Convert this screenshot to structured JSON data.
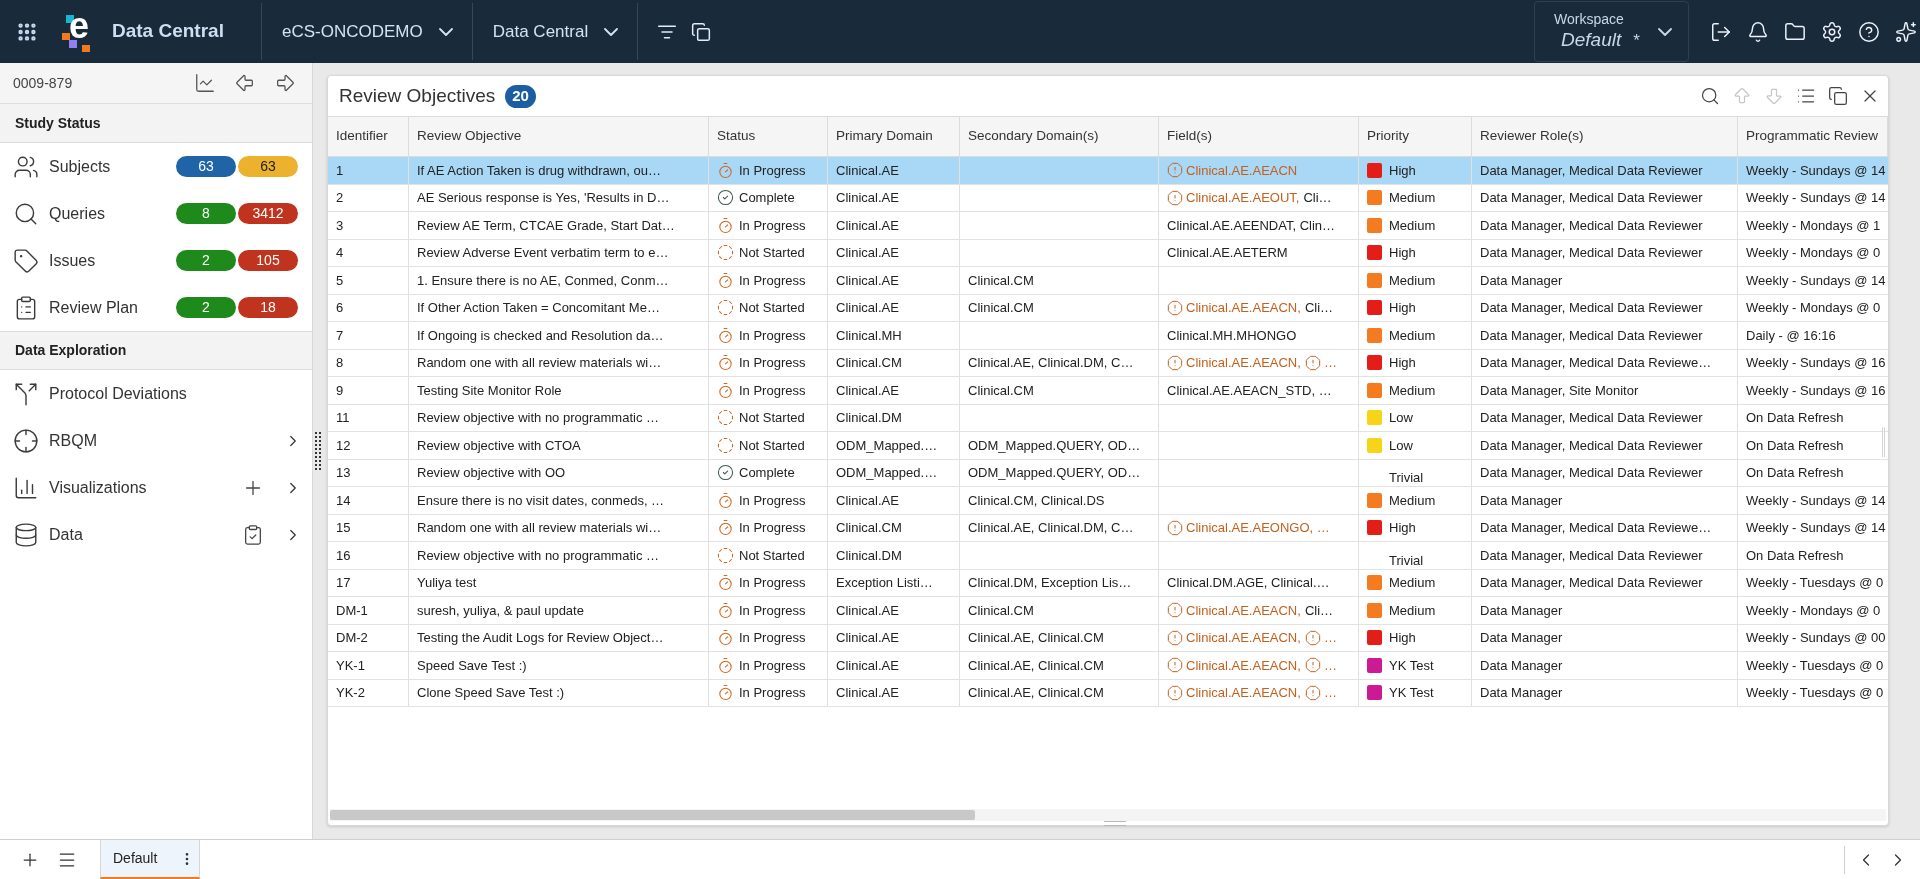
{
  "app_bar": {
    "logo_mark": "e",
    "title": "Data Central",
    "menus": [
      {
        "label": "eCS-ONCODEMO"
      },
      {
        "label": "Data Central"
      }
    ],
    "workspace": {
      "label": "Workspace",
      "value": "Default",
      "unsaved_mark": "*"
    }
  },
  "sidebar": {
    "record_id": "0009-879",
    "sections": [
      {
        "title": "Study Status",
        "items": [
          {
            "kind": "counts",
            "label": "Subjects",
            "badges": [
              {
                "value": "63",
                "color": "#1f64a6"
              },
              {
                "value": "63",
                "color": "#ecb22e"
              }
            ]
          },
          {
            "kind": "counts",
            "label": "Queries",
            "badges": [
              {
                "value": "8",
                "color": "#1f8a1c"
              },
              {
                "value": "3412",
                "color": "#c0341f"
              }
            ]
          },
          {
            "kind": "counts",
            "label": "Issues",
            "badges": [
              {
                "value": "2",
                "color": "#1f8a1c"
              },
              {
                "value": "105",
                "color": "#c0341f"
              }
            ]
          },
          {
            "kind": "counts",
            "label": "Review Plan",
            "badges": [
              {
                "value": "2",
                "color": "#1f8a1c"
              },
              {
                "value": "18",
                "color": "#c0341f"
              }
            ]
          }
        ]
      },
      {
        "title": "Data Exploration",
        "items": [
          {
            "kind": "link",
            "label": "Protocol Deviations"
          },
          {
            "kind": "submenu",
            "label": "RBQM"
          },
          {
            "kind": "submenu",
            "label": "Visualizations"
          },
          {
            "kind": "submenu",
            "label": "Data"
          }
        ]
      }
    ]
  },
  "panel": {
    "title": "Review Objectives",
    "count": "20",
    "toolbar": [
      {
        "disabled": false
      },
      {
        "disabled": true
      },
      {
        "disabled": true
      },
      {
        "disabled": false
      },
      {
        "disabled": false
      },
      {
        "disabled": false
      }
    ]
  },
  "table": {
    "columns": [
      "Identifier",
      "Review Objective",
      "Status",
      "Primary Domain",
      "Secondary Domain(s)",
      "Field(s)",
      "Priority",
      "Reviewer Role(s)",
      "Programmatic Review"
    ],
    "rows": [
      {
        "selected": true,
        "id": "1",
        "objective": "If AE Action Taken is drug withdrawn, ou…",
        "status": {
          "kind": "in_progress",
          "label": "In Progress"
        },
        "primary": "Clinical.AE",
        "fields": [
          {
            "text": "Clinical.AE.AEACN",
            "flagged": true
          }
        ],
        "priority": {
          "label": "High",
          "color": "#e31e18"
        },
        "roles": "Data Manager, Medical Data Reviewer",
        "schedule": "Weekly - Sundays @ 14"
      },
      {
        "selected": false,
        "id": "2",
        "objective": "AE Serious response is Yes, 'Results in D…",
        "status": {
          "kind": "complete",
          "label": "Complete"
        },
        "primary": "Clinical.AE",
        "fields": [
          {
            "text": "Clinical.AE.AEOUT,",
            "flagged": true
          },
          {
            "text": "Cli…",
            "flagged": false
          }
        ],
        "priority": {
          "label": "Medium",
          "color": "#f47b20"
        },
        "roles": "Data Manager, Medical Data Reviewer",
        "schedule": "Weekly - Sundays @ 14"
      },
      {
        "selected": false,
        "id": "3",
        "objective": "Review AE Term, CTCAE Grade, Start Dat…",
        "status": {
          "kind": "in_progress",
          "label": "In Progress"
        },
        "primary": "Clinical.AE",
        "fields": [
          {
            "text": "Clinical.AE.AEENDAT, Clin…",
            "flagged": false
          }
        ],
        "priority": {
          "label": "Medium",
          "color": "#f47b20"
        },
        "roles": "Data Manager, Medical Data Reviewer",
        "schedule": "Weekly - Mondays @ 1"
      },
      {
        "selected": false,
        "id": "4",
        "objective": "Review Adverse Event verbatim term to e…",
        "status": {
          "kind": "not_started",
          "label": "Not Started"
        },
        "primary": "Clinical.AE",
        "fields": [
          {
            "text": "Clinical.AE.AETERM",
            "flagged": false
          }
        ],
        "priority": {
          "label": "High",
          "color": "#e31e18"
        },
        "roles": "Data Manager, Medical Data Reviewer",
        "schedule": "Weekly - Mondays @ 0"
      },
      {
        "selected": false,
        "id": "5",
        "objective": "1. Ensure there is no AE, Conmed, Conm…",
        "status": {
          "kind": "in_progress",
          "label": "In Progress"
        },
        "primary": "Clinical.AE",
        "secondary": "Clinical.CM",
        "priority": {
          "label": "Medium",
          "color": "#f47b20"
        },
        "roles": "Data Manager",
        "schedule": "Weekly - Sundays @ 14"
      },
      {
        "selected": false,
        "id": "6",
        "objective": "If Other Action Taken = Concomitant Me…",
        "status": {
          "kind": "not_started",
          "label": "Not Started"
        },
        "primary": "Clinical.AE",
        "secondary": "Clinical.CM",
        "fields": [
          {
            "text": "Clinical.AE.AEACN,",
            "flagged": true
          },
          {
            "text": "Cli…",
            "flagged": false
          }
        ],
        "priority": {
          "label": "High",
          "color": "#e31e18"
        },
        "roles": "Data Manager, Medical Data Reviewer",
        "schedule": "Weekly - Mondays @ 0"
      },
      {
        "selected": false,
        "id": "7",
        "objective": "If Ongoing is checked and Resolution da…",
        "status": {
          "kind": "in_progress",
          "label": "In Progress"
        },
        "primary": "Clinical.MH",
        "fields": [
          {
            "text": "Clinical.MH.MHONGO",
            "flagged": false
          }
        ],
        "priority": {
          "label": "Medium",
          "color": "#f47b20"
        },
        "roles": "Data Manager, Medical Data Reviewer",
        "schedule": "Daily - @ 16:16"
      },
      {
        "selected": false,
        "id": "8",
        "objective": "Random one with all review materials wi…",
        "status": {
          "kind": "in_progress",
          "label": "In Progress"
        },
        "primary": "Clinical.CM",
        "secondary": "Clinical.AE, Clinical.DM, C…",
        "fields": [
          {
            "text": "Clinical.AE.AEACN,",
            "flagged": true
          },
          {
            "text": "…",
            "flagged": true
          }
        ],
        "priority": {
          "label": "High",
          "color": "#e31e18"
        },
        "roles": "Data Manager, Medical Data Reviewe…",
        "schedule": "Weekly - Sundays @ 16"
      },
      {
        "selected": false,
        "id": "9",
        "objective": "Testing Site Monitor Role",
        "status": {
          "kind": "in_progress",
          "label": "In Progress"
        },
        "primary": "Clinical.AE",
        "secondary": "Clinical.CM",
        "fields": [
          {
            "text": "Clinical.AE.AEACN_STD, …",
            "flagged": false
          }
        ],
        "priority": {
          "label": "Medium",
          "color": "#f47b20"
        },
        "roles": "Data Manager, Site Monitor",
        "schedule": "Weekly - Sundays @ 16"
      },
      {
        "selected": false,
        "id": "11",
        "objective": "Review objective with no programmatic …",
        "status": {
          "kind": "not_started",
          "label": "Not Started"
        },
        "primary": "Clinical.DM",
        "priority": {
          "label": "Low",
          "color": "#f7d417"
        },
        "roles": "Data Manager, Medical Data Reviewer",
        "schedule": "On Data Refresh"
      },
      {
        "selected": false,
        "id": "12",
        "objective": "Review objective with CTOA",
        "status": {
          "kind": "not_started",
          "label": "Not Started"
        },
        "primary": "ODM_Mapped.…",
        "secondary": "ODM_Mapped.QUERY, OD…",
        "priority": {
          "label": "Low",
          "color": "#f7d417"
        },
        "roles": "Data Manager, Medical Data Reviewer",
        "schedule": "On Data Refresh"
      },
      {
        "selected": false,
        "id": "13",
        "objective": "Review objective with OO",
        "status": {
          "kind": "complete",
          "label": "Complete"
        },
        "primary": "ODM_Mapped.…",
        "secondary": "ODM_Mapped.QUERY, OD…",
        "priority": {
          "label": "Trivial"
        },
        "roles": "Data Manager, Medical Data Reviewer",
        "schedule": "On Data Refresh"
      },
      {
        "selected": false,
        "id": "14",
        "objective": "Ensure there is no visit dates, conmeds, …",
        "status": {
          "kind": "in_progress",
          "label": "In Progress"
        },
        "primary": "Clinical.AE",
        "secondary": "Clinical.CM, Clinical.DS",
        "priority": {
          "label": "Medium",
          "color": "#f47b20"
        },
        "roles": "Data Manager",
        "schedule": "Weekly - Sundays @ 14"
      },
      {
        "selected": false,
        "id": "15",
        "objective": "Random one with all review materials wi…",
        "status": {
          "kind": "in_progress",
          "label": "In Progress"
        },
        "primary": "Clinical.CM",
        "secondary": "Clinical.AE, Clinical.DM, C…",
        "fields": [
          {
            "text": "Clinical.AE.AEONGO, …",
            "flagged": true
          }
        ],
        "priority": {
          "label": "High",
          "color": "#e31e18"
        },
        "roles": "Data Manager, Medical Data Reviewe…",
        "schedule": "Weekly - Sundays @ 14"
      },
      {
        "selected": false,
        "id": "16",
        "objective": "Review objective with no programmatic …",
        "status": {
          "kind": "not_started",
          "label": "Not Started"
        },
        "primary": "Clinical.DM",
        "priority": {
          "label": "Trivial"
        },
        "roles": "Data Manager, Medical Data Reviewer",
        "schedule": "On Data Refresh"
      },
      {
        "selected": false,
        "id": "17",
        "objective": "Yuliya test",
        "status": {
          "kind": "in_progress",
          "label": "In Progress"
        },
        "primary": "Exception Listi…",
        "secondary": "Clinical.DM, Exception Lis…",
        "fields": [
          {
            "text": "Clinical.DM.AGE, Clinical.…",
            "flagged": false
          }
        ],
        "priority": {
          "label": "Medium",
          "color": "#f47b20"
        },
        "roles": "Data Manager, Medical Data Reviewer",
        "schedule": "Weekly - Tuesdays @ 0"
      },
      {
        "selected": false,
        "id": "DM-1",
        "objective": "suresh, yuliya, & paul update",
        "status": {
          "kind": "in_progress",
          "label": "In Progress"
        },
        "primary": "Clinical.AE",
        "secondary": "Clinical.CM",
        "fields": [
          {
            "text": "Clinical.AE.AEACN,",
            "flagged": true
          },
          {
            "text": "Cli…",
            "flagged": false
          }
        ],
        "priority": {
          "label": "Medium",
          "color": "#f47b20"
        },
        "roles": "Data Manager",
        "schedule": "Weekly - Mondays @ 0"
      },
      {
        "selected": false,
        "id": "DM-2",
        "objective": "Testing the Audit Logs for Review Object…",
        "status": {
          "kind": "in_progress",
          "label": "In Progress"
        },
        "primary": "Clinical.AE",
        "secondary": "Clinical.AE, Clinical.CM",
        "fields": [
          {
            "text": "Clinical.AE.AEACN,",
            "flagged": true
          },
          {
            "text": "…",
            "flagged": true
          }
        ],
        "priority": {
          "label": "High",
          "color": "#e31e18"
        },
        "roles": "Data Manager",
        "schedule": "Weekly - Sundays @ 00"
      },
      {
        "selected": false,
        "id": "YK-1",
        "objective": "Speed Save Test :)",
        "status": {
          "kind": "in_progress",
          "label": "In Progress"
        },
        "primary": "Clinical.AE",
        "secondary": "Clinical.AE, Clinical.CM",
        "fields": [
          {
            "text": "Clinical.AE.AEACN,",
            "flagged": true
          },
          {
            "text": "…",
            "flagged": true
          }
        ],
        "priority": {
          "label": "YK Test",
          "color": "#cc1a96"
        },
        "roles": "Data Manager",
        "schedule": "Weekly - Tuesdays @ 0"
      },
      {
        "selected": false,
        "id": "YK-2",
        "objective": "Clone Speed Save Test :)",
        "status": {
          "kind": "in_progress",
          "label": "In Progress"
        },
        "primary": "Clinical.AE",
        "secondary": "Clinical.AE, Clinical.CM",
        "fields": [
          {
            "text": "Clinical.AE.AEACN,",
            "flagged": true
          },
          {
            "text": "…",
            "flagged": true
          }
        ],
        "priority": {
          "label": "YK Test",
          "color": "#cc1a96"
        },
        "roles": "Data Manager",
        "schedule": "Weekly - Tuesdays @ 0"
      }
    ]
  },
  "bottom_bar": {
    "tabs": [
      {
        "label": "Default",
        "selected": true
      }
    ]
  }
}
